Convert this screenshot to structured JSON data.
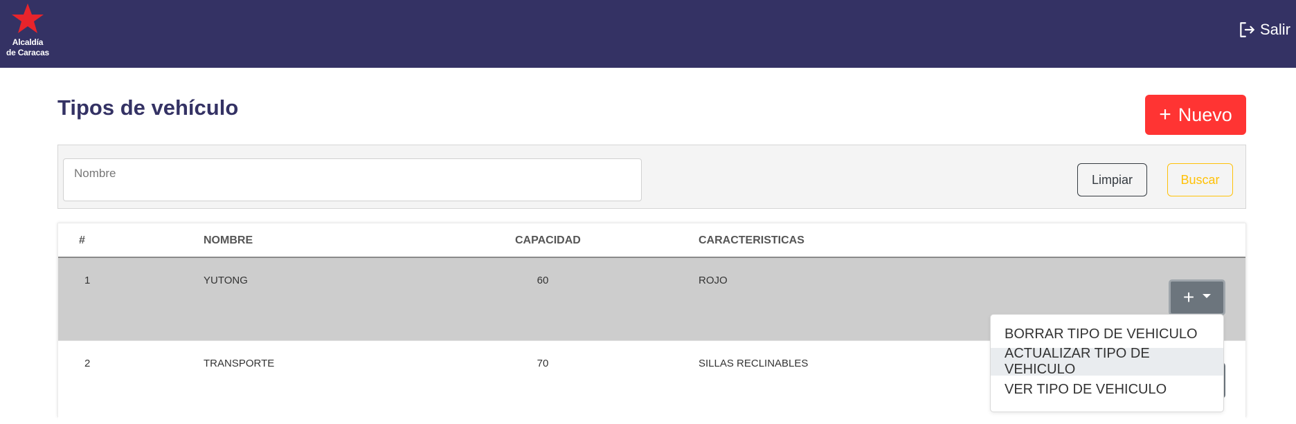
{
  "header": {
    "logo_line1": "Alcaldía",
    "logo_line2": "de Caracas",
    "logout_label": "Salir",
    "brand_color": "#343264"
  },
  "page": {
    "title": "Tipos de vehículo",
    "new_button_plus": "+",
    "new_button_label": "Nuevo"
  },
  "filter": {
    "name_placeholder": "Nombre",
    "name_value": "",
    "clear_label": "Limpiar",
    "search_label": "Buscar"
  },
  "table": {
    "headers": [
      "#",
      "NOMBRE",
      "CAPACIDAD",
      "CARACTERISTICAS"
    ],
    "rows": [
      {
        "num": "1",
        "name": "YUTONG",
        "capacity": "60",
        "characteristics": "ROJO"
      },
      {
        "num": "2",
        "name": "TRANSPORTE",
        "capacity": "70",
        "characteristics": "SILLAS RECLINABLES"
      }
    ],
    "actions_plus": "+"
  },
  "actions_menu": {
    "items": [
      "BORRAR TIPO DE VEHICULO",
      "ACTUALIZAR TIPO DE VEHICULO",
      "VER TIPO DE VEHICULO"
    ],
    "highlighted_index": 1
  },
  "colors": {
    "accent_red": "#ff3433",
    "warning": "#ffc107",
    "secondary": "#6c757d"
  },
  "icons": {
    "logo": "star-icon",
    "logout": "logout-icon",
    "actions_caret": "caret-down-icon"
  }
}
